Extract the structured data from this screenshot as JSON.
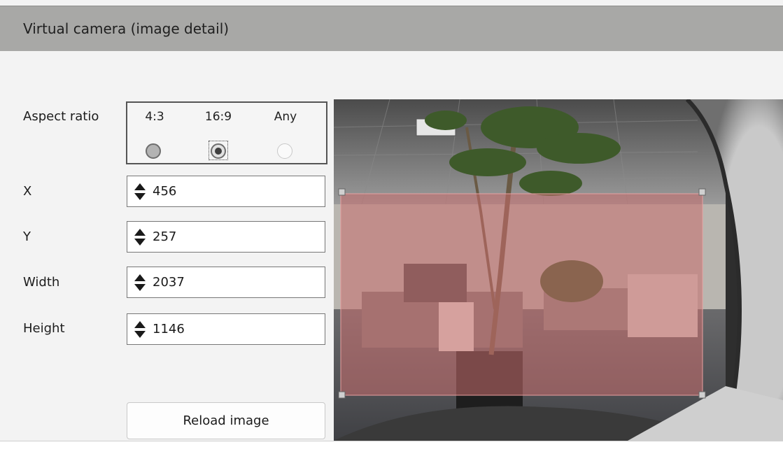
{
  "header": {
    "title": "Virtual camera (image detail)"
  },
  "aspect_ratio": {
    "label": "Aspect ratio",
    "options": [
      {
        "label": "4:3",
        "state": "unselected"
      },
      {
        "label": "16:9",
        "state": "selected"
      },
      {
        "label": "Any",
        "state": "disabled"
      }
    ]
  },
  "fields": {
    "x": {
      "label": "X",
      "value": "456"
    },
    "y": {
      "label": "Y",
      "value": "257"
    },
    "width": {
      "label": "Width",
      "value": "2037"
    },
    "height": {
      "label": "Height",
      "value": "1146"
    }
  },
  "reload_button": {
    "label": "Reload image"
  },
  "preview": {
    "description_icon": "fisheye-camera-image",
    "selection_color": "#c86e6e"
  }
}
